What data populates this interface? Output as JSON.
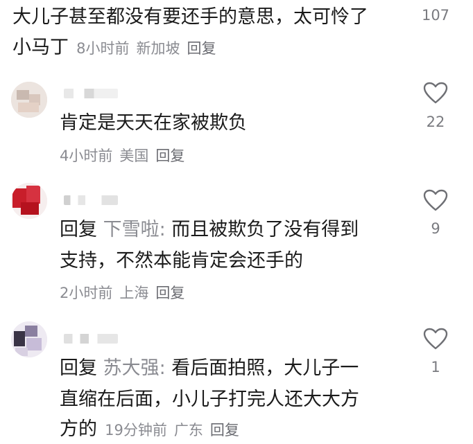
{
  "top_comment": {
    "text_line1": "大儿子甚至都没有要还手的意思，太可怜了",
    "text_line2": "小马丁",
    "time": "8小时前",
    "location": "新加坡",
    "reply_label": "回复",
    "like_count": "107"
  },
  "replies": [
    {
      "text": "肯定是天天在家被欺负",
      "time": "4小时前",
      "location": "美国",
      "reply_label": "回复",
      "like_count": "22"
    },
    {
      "reply_prefix": "回复",
      "mention": "下雪啦:",
      "text_line1": "而且被欺负了没有得到",
      "text_line2": "支持，不然本能肯定会还手的",
      "time": "2小时前",
      "location": "上海",
      "reply_label": "回复",
      "like_count": "9"
    },
    {
      "reply_prefix": "回复",
      "mention": "苏大强:",
      "text_line1": "看后面拍照，大儿子一",
      "text_line2": "直缩在后面，小儿子打完人还大大方",
      "text_line3": "方的",
      "time": "19分钟前",
      "location": "广东",
      "reply_label": "回复",
      "like_count": "1"
    }
  ],
  "colors": {
    "text": "#1a1a1a",
    "meta": "#8a8b91",
    "heart": "#7a7b80"
  }
}
